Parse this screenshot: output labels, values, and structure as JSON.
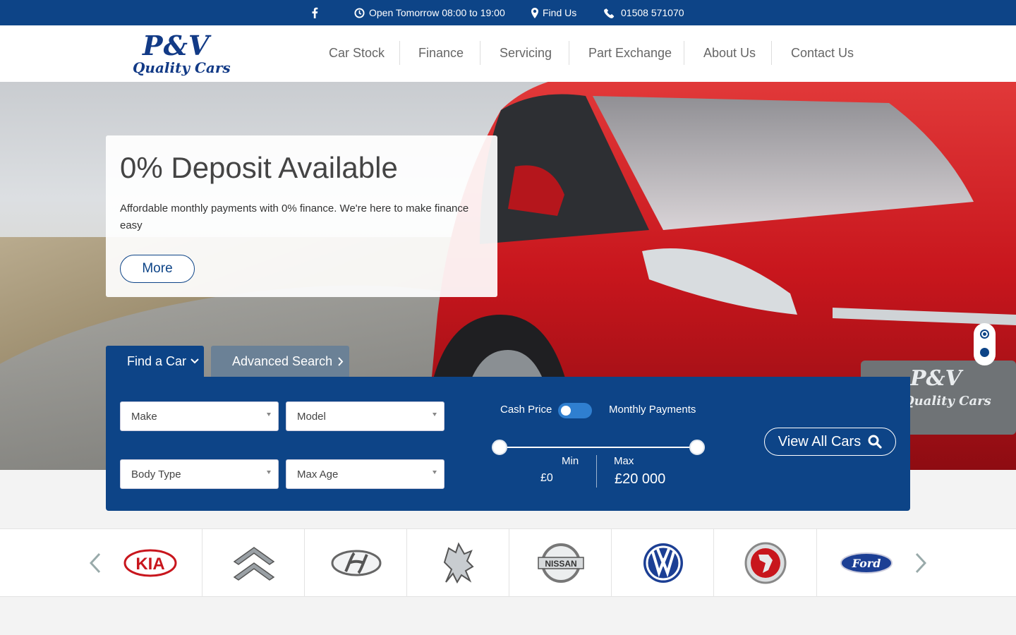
{
  "topbar": {
    "facebook_icon": "facebook-icon",
    "hours": "Open Tomorrow 08:00 to 19:00",
    "find_us": "Find Us",
    "phone": "01508 571070"
  },
  "logo": {
    "line1": "P&V",
    "line2": "Quality Cars"
  },
  "nav": {
    "items": [
      "Car Stock",
      "Finance",
      "Servicing",
      "Part Exchange",
      "About Us",
      "Contact Us"
    ]
  },
  "hero": {
    "title": "0% Deposit Available",
    "text": "Affordable monthly payments with 0% finance. We're here to make finance easy",
    "more_label": "More",
    "slides": 2,
    "active_slide": 1,
    "plate_line1": "P&V",
    "plate_line2": "Quality Cars"
  },
  "search": {
    "tab_find": "Find a Car",
    "tab_advanced": "Advanced Search",
    "make": "Make",
    "model": "Model",
    "body_type": "Body Type",
    "max_age": "Max Age",
    "cash_price": "Cash Price",
    "monthly_payments": "Monthly Payments",
    "min_label": "Min",
    "max_label": "Max",
    "min_value": "£0",
    "max_value": "£20 000",
    "view_all": "View All Cars"
  },
  "brands": [
    "Kia",
    "Citroen",
    "Hyundai",
    "Peugeot",
    "Nissan",
    "Volkswagen",
    "Vauxhall",
    "Ford"
  ],
  "colors": {
    "brand_blue": "#0d4487",
    "car_red": "#c8161d",
    "tab_grey": "#6b8196"
  }
}
